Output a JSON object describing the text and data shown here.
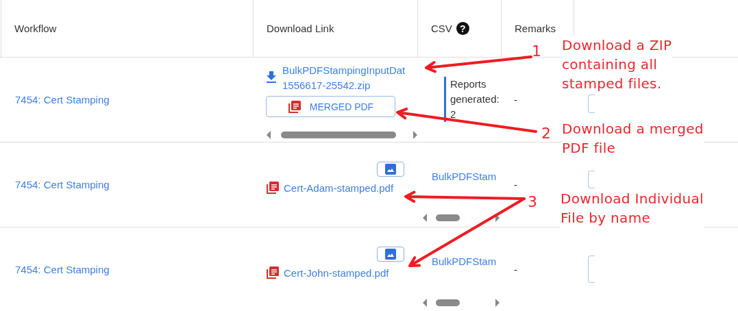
{
  "table": {
    "columns": [
      {
        "label": "Workflow"
      },
      {
        "label": "Download Link"
      },
      {
        "label": "CSV",
        "icon": "?"
      },
      {
        "label": "Remarks"
      }
    ],
    "rows": [
      {
        "kind": "zip",
        "workflow": "7454: Cert Stamping",
        "zip_lines": [
          "BulkPDFStampingInputDat",
          "1556617-25542.zip"
        ],
        "button": "MERGED PDF",
        "csv": "Reports generated: 2",
        "remarks": "-"
      },
      {
        "kind": "file",
        "workflow": "7454: Cert Stamping",
        "file": "Cert-Adam-stamped.pdf",
        "csv": "BulkPDFStam",
        "remarks": "-"
      },
      {
        "kind": "file",
        "workflow": "7454: Cert Stamping",
        "file": "Cert-John-stamped.pdf",
        "csv": "BulkPDFStam",
        "remarks": "-"
      }
    ]
  },
  "annotations": [
    {
      "number": "1",
      "lines": [
        "Download a ZIP",
        "containing all",
        "stamped files."
      ]
    },
    {
      "number": "2",
      "lines": [
        "Download a merged",
        "PDF file"
      ]
    },
    {
      "number": "3",
      "lines": [
        "Download Individual",
        "File by name"
      ]
    }
  ]
}
